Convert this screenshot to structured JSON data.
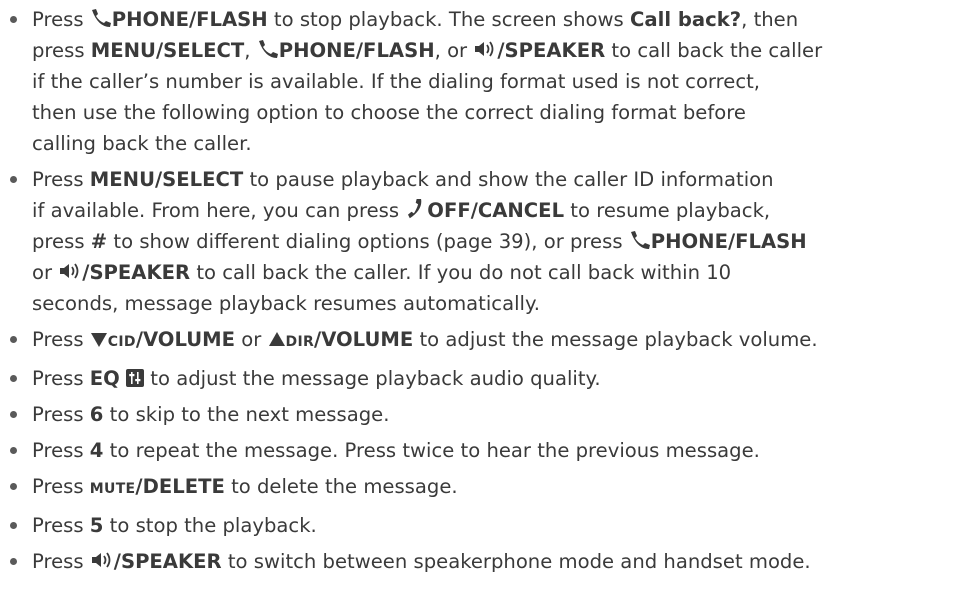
{
  "items": [
    {
      "lines": [
        [
          "Press ",
          {
            "icon": "phone-icon"
          },
          {
            "b": "PHONE/FLASH"
          },
          " to stop playback. The screen shows ",
          {
            "b": "Call back?"
          },
          ", then"
        ],
        [
          "press ",
          {
            "b": "MENU/SELECT"
          },
          ", ",
          {
            "icon": "phone-icon"
          },
          {
            "b": "PHONE/FLASH"
          },
          ", or ",
          {
            "icon": "speaker-icon"
          },
          {
            "b": "/SPEAKER"
          },
          " to call back the caller"
        ],
        [
          "if the caller’s number is available. If the dialing format used is not correct,"
        ],
        [
          "then use the following option to choose the correct dialing format before"
        ],
        [
          "calling back the caller."
        ]
      ]
    },
    {
      "lines": [
        [
          "Press ",
          {
            "b": "MENU/SELECT"
          },
          " to pause playback and show the caller ID information"
        ],
        [
          "if available. From here, you can press ",
          {
            "icon": "off-icon"
          },
          {
            "b": "OFF/CANCEL"
          },
          " to resume playback,"
        ],
        [
          "press ",
          {
            "b": "#"
          },
          " to show different dialing options (page 39), or press ",
          {
            "icon": "phone-icon"
          },
          {
            "b": "PHONE/FLASH"
          }
        ],
        [
          "or ",
          {
            "icon": "speaker-icon"
          },
          {
            "b": "/SPEAKER"
          },
          " to call back the caller. If you do not call back within 10"
        ],
        [
          "seconds, message playback resumes automatically."
        ]
      ]
    },
    {
      "lines": [
        [
          "Press ",
          {
            "icon": "down-triangle-icon"
          },
          {
            "sc": "CID"
          },
          {
            "b": "/VOLUME"
          },
          " or ",
          {
            "icon": "up-triangle-icon"
          },
          {
            "sc": "DIR"
          },
          {
            "b": "/VOLUME"
          },
          " to adjust the message playback volume."
        ]
      ]
    },
    {
      "lines": [
        [
          "Press ",
          {
            "b": "EQ"
          },
          " ",
          {
            "icon": "eq-icon"
          },
          " to adjust the message playback audio quality."
        ]
      ]
    },
    {
      "lines": [
        [
          "Press ",
          {
            "b": "6"
          },
          " to skip to the next message."
        ]
      ]
    },
    {
      "lines": [
        [
          "Press ",
          {
            "b": "4"
          },
          " to repeat the message. Press twice to hear the previous message."
        ]
      ]
    },
    {
      "lines": [
        [
          "Press ",
          {
            "sc": "MUTE"
          },
          {
            "b": "/DELETE"
          },
          " to delete the message."
        ]
      ]
    },
    {
      "lines": [
        [
          "Press ",
          {
            "b": "5"
          },
          " to stop the playback."
        ]
      ]
    },
    {
      "lines": [
        [
          "Press ",
          {
            "icon": "speaker-icon"
          },
          {
            "b": "/SPEAKER"
          },
          " to switch between speakerphone mode and handset mode."
        ]
      ]
    }
  ]
}
